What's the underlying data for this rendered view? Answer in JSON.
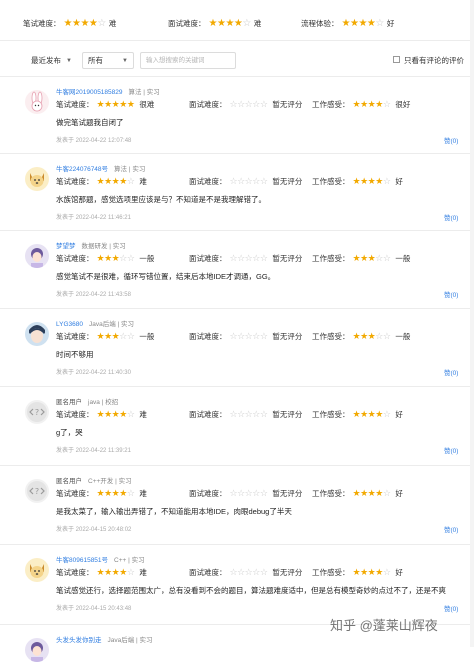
{
  "summary": {
    "items": [
      {
        "label": "笔试难度：",
        "rating": 4,
        "value": "难"
      },
      {
        "label": "面试难度：",
        "rating": 4,
        "value": "难"
      },
      {
        "label": "流程体验：",
        "rating": 4,
        "value": "好"
      }
    ]
  },
  "filters": {
    "sort": "最近发布",
    "category": "所有",
    "search_placeholder": "输入想搜索的关键词",
    "only_with_comments": "只看有评论的评价"
  },
  "labels": {
    "written": "笔试难度：",
    "interview": "面试难度：",
    "work": "工作感受：",
    "posted_prefix": "发表于 ",
    "like": "赞(0)"
  },
  "reviews": [
    {
      "user": "牛客网2019005185829",
      "tags": "算法 | 实习",
      "written_rating": 5,
      "written_value": "很难",
      "interview_rating": 0,
      "interview_value": "暂无评分",
      "work_rating": 4,
      "work_value": "很好",
      "content": "做完笔试题我自闭了",
      "posted": "2022-04-22 12:07:48",
      "avatar": "rabbit"
    },
    {
      "user": "牛客224076748号",
      "tags": "算法 | 实习",
      "written_rating": 4,
      "written_value": "难",
      "interview_rating": 0,
      "interview_value": "暂无评分",
      "work_rating": 4,
      "work_value": "好",
      "content": "水族馆那题，感觉选项里应该是与？不知道是不是我理解错了。",
      "posted": "2022-04-22 11:46:21",
      "avatar": "dog"
    },
    {
      "user": "梦望梦",
      "tags": "数据研发 | 实习",
      "written_rating": 3,
      "written_value": "一般",
      "interview_rating": 0,
      "interview_value": "暂无评分",
      "work_rating": 3,
      "work_value": "一般",
      "content": "感觉笔试不是很难，循环写错位置，结束后本地IDE才调通，GG。",
      "posted": "2022-04-22 11:43:58",
      "avatar": "girl"
    },
    {
      "user": "LYG3680",
      "tags": "Java后端 | 实习",
      "written_rating": 3,
      "written_value": "一般",
      "interview_rating": 0,
      "interview_value": "暂无评分",
      "work_rating": 3,
      "work_value": "一般",
      "content": "时间不够用",
      "posted": "2022-04-22 11:40:30",
      "avatar": "anime"
    },
    {
      "user": "匿名用户",
      "tags": "java | 校招",
      "written_rating": 4,
      "written_value": "难",
      "interview_rating": 0,
      "interview_value": "暂无评分",
      "work_rating": 4,
      "work_value": "好",
      "content": "g了，哭",
      "posted": "2022-04-22 11:39:21",
      "avatar": "anon"
    },
    {
      "user": "匿名用户",
      "tags": "C++开发 | 实习",
      "written_rating": 4,
      "written_value": "难",
      "interview_rating": 0,
      "interview_value": "暂无评分",
      "work_rating": 4,
      "work_value": "好",
      "content": "是我太菜了，输入输出弄错了，不知道能用本地IDE，肉眼debug了半天",
      "posted": "2022-04-15 20:48:02",
      "avatar": "anon"
    },
    {
      "user": "牛客809615851号",
      "tags": "C++ | 实习",
      "written_rating": 4,
      "written_value": "难",
      "interview_rating": 0,
      "interview_value": "暂无评分",
      "work_rating": 4,
      "work_value": "好",
      "content": "笔试感觉还行，选择题范围太广，总有没看到不会的题目，算法题难度适中，但是总有模型奇妙的点过不了，还是不爽",
      "posted": "2022-04-15 20:43:48",
      "avatar": "dog"
    },
    {
      "user": "头发头发你别走",
      "tags": "Java后端 | 实习",
      "written_rating": 0,
      "written_value": "",
      "interview_rating": 0,
      "interview_value": "",
      "work_rating": 0,
      "work_value": "",
      "content": "",
      "posted": "",
      "avatar": "girl"
    }
  ],
  "watermark": "知乎 @蓬莱山辉夜",
  "colors": {
    "star": "#f2a900",
    "star_empty": "#c8c8c8",
    "link": "#2f7de1"
  }
}
